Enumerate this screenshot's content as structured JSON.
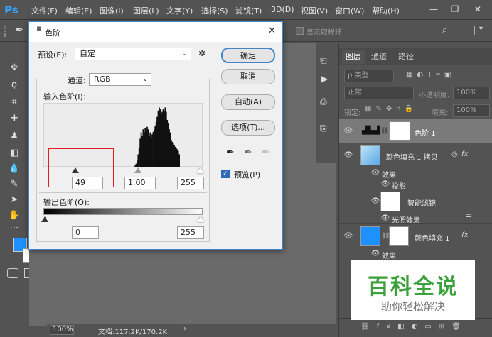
{
  "app": {
    "logo": "Ps"
  },
  "menu": [
    "文件(F)",
    "编辑(E)",
    "图像(I)",
    "图层(L)",
    "文字(Y)",
    "选择(S)",
    "滤镜(T)",
    "3D(D)",
    "视图(V)",
    "窗口(W)",
    "帮助(H)"
  ],
  "window_controls": {
    "minimize": "—",
    "restore": "❐",
    "close": "✕"
  },
  "options": {
    "sample_all_layers": "显示取样环"
  },
  "dialog": {
    "title": "色阶",
    "close": "✕",
    "preset_label": "预设(E):",
    "preset_value": "自定",
    "channel_label": "通道:",
    "channel_value": "RGB",
    "input_levels_label": "输入色阶(I):",
    "input_black": "49",
    "input_gamma": "1.00",
    "input_white": "255",
    "output_levels_label": "输出色阶(O):",
    "output_black": "0",
    "output_white": "255",
    "ok": "确定",
    "cancel": "取消",
    "auto": "自动(A)",
    "options": "选项(T)...",
    "preview_label": "预览(P)",
    "preview_checked": true
  },
  "histogram": {
    "peaks": [
      0,
      0,
      0,
      0,
      0,
      0,
      0,
      0,
      0,
      0,
      0,
      0,
      0,
      0,
      0,
      0,
      0,
      0,
      0,
      0,
      0,
      0,
      0,
      0,
      0,
      0,
      0,
      0,
      0,
      0,
      0,
      0,
      0,
      0,
      0,
      0,
      0,
      0,
      0,
      0,
      0,
      0,
      0,
      0,
      0,
      0,
      0,
      0,
      0,
      0,
      0,
      0,
      0,
      0,
      0,
      0,
      0,
      0,
      0,
      0,
      0,
      0,
      0,
      0,
      0,
      0,
      0,
      0,
      0,
      0,
      0,
      0,
      0,
      0,
      0,
      0,
      0,
      0,
      0,
      0,
      0,
      0,
      0,
      0,
      0,
      0,
      0,
      0,
      0,
      0,
      0,
      0.02,
      0.05,
      0.1,
      0.2,
      0.3,
      0.45,
      0.55,
      0.5,
      0.6,
      0.55,
      0.62,
      0.58,
      0.64,
      0.6,
      0.5,
      0.55,
      0.45,
      0.52,
      0.56,
      0.6,
      0.66,
      0.72,
      0.8,
      0.9,
      0.95,
      0.92,
      0.85,
      0.88,
      0.92,
      0.9,
      0.95,
      0.88,
      0.75,
      0.7,
      0.6,
      0.55,
      0.42,
      0.4,
      0.38,
      0.35,
      0.32,
      0.3,
      0.28,
      0.25,
      0.2,
      0,
      0,
      0,
      0,
      0,
      0,
      0,
      0,
      0,
      0,
      0,
      0,
      0,
      0,
      0,
      0,
      0,
      0,
      0,
      0,
      0,
      0,
      0
    ]
  },
  "panel": {
    "tabs": [
      "图层",
      "通道",
      "路径"
    ],
    "filter_kind": "ρ 类型",
    "blend_mode": "正常",
    "opacity_label": "不透明度:",
    "opacity_value": "100%",
    "lock_label": "锁定:",
    "fill_label": "填充:",
    "fill_value": "100%",
    "layers": [
      {
        "name": "色阶 1"
      },
      {
        "name": "颜色填充 1 拷贝",
        "fx": "fx"
      },
      {
        "name": "效果"
      },
      {
        "name": "投影"
      },
      {
        "name": "智能滤镜"
      },
      {
        "name": "光照效果"
      },
      {
        "name": "颜色填充 1",
        "fx": "fx"
      },
      {
        "name": "效果"
      }
    ]
  },
  "status": {
    "zoom": "100%",
    "doc": "文档:117.2K/170.2K"
  },
  "watermark": {
    "title": "百科全说",
    "subtitle": "助你轻松解决"
  },
  "colors": {
    "foreground": "#1e90ff",
    "background": "#ffffff"
  }
}
